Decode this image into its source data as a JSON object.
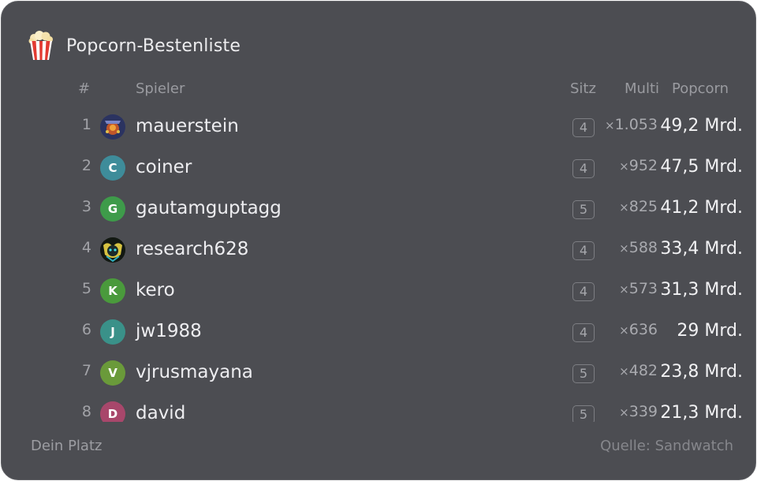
{
  "title": "Popcorn-Bestenliste",
  "columns": {
    "rank": "#",
    "player": "Spieler",
    "seat": "Sitz",
    "multi": "Multi",
    "popcorn": "Popcorn"
  },
  "rows": [
    {
      "rank": "1",
      "initial": "",
      "avatar_type": "image",
      "color": "#3a3f66",
      "name": "mauerstein",
      "seat": "4",
      "multi_prefix": "×",
      "multi": "1.053",
      "popcorn": "49,2 Mrd."
    },
    {
      "rank": "2",
      "initial": "C",
      "avatar_type": "letter",
      "color": "#3e8c9a",
      "name": "coiner",
      "seat": "4",
      "multi_prefix": "×",
      "multi": "952",
      "popcorn": "47,5 Mrd."
    },
    {
      "rank": "3",
      "initial": "G",
      "avatar_type": "letter",
      "color": "#3e9b4a",
      "name": "gautamguptagg",
      "seat": "5",
      "multi_prefix": "×",
      "multi": "825",
      "popcorn": "41,2 Mrd."
    },
    {
      "rank": "4",
      "initial": "",
      "avatar_type": "image",
      "color": "#1e2a1e",
      "name": "research628",
      "seat": "4",
      "multi_prefix": "×",
      "multi": "588",
      "popcorn": "33,4 Mrd."
    },
    {
      "rank": "5",
      "initial": "K",
      "avatar_type": "letter",
      "color": "#4a9a3c",
      "name": "kero",
      "seat": "4",
      "multi_prefix": "×",
      "multi": "573",
      "popcorn": "31,3 Mrd."
    },
    {
      "rank": "6",
      "initial": "J",
      "avatar_type": "letter",
      "color": "#3a9189",
      "name": "jw1988",
      "seat": "4",
      "multi_prefix": "×",
      "multi": "636",
      "popcorn": "29 Mrd."
    },
    {
      "rank": "7",
      "initial": "V",
      "avatar_type": "letter",
      "color": "#6a9a3a",
      "name": "vjrusmayana",
      "seat": "5",
      "multi_prefix": "×",
      "multi": "482",
      "popcorn": "23,8 Mrd."
    },
    {
      "rank": "8",
      "initial": "D",
      "avatar_type": "letter",
      "color": "#a8476b",
      "name": "david",
      "seat": "5",
      "multi_prefix": "×",
      "multi": "339",
      "popcorn": "21,3 Mrd."
    }
  ],
  "footer": {
    "left": "Dein Platz",
    "right": "Quelle: Sandwatch"
  },
  "icons": {
    "header": "popcorn-icon"
  },
  "colors": {
    "card_bg": "#4c4d52",
    "text": "#ececee",
    "muted": "#9a9ba0"
  }
}
